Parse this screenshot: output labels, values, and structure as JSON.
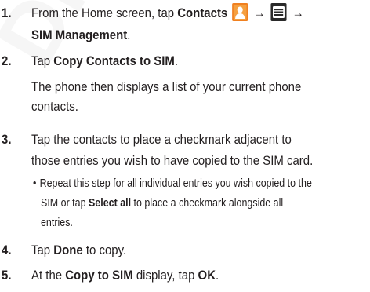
{
  "colors": {
    "text": "#231f20",
    "contacts_icon_bg": "#f08020",
    "menu_icon_bg": "#2a2a2a"
  },
  "steps": [
    {
      "number": "1.",
      "line1": {
        "pre": "From the Home screen, tap ",
        "bold1": "Contacts",
        "contacts_icon": "contacts-person-icon",
        "arrow1": "→",
        "menu_icon": "menu-list-icon",
        "arrow2": "→"
      },
      "line2": {
        "bold": "SIM Management",
        "post": "."
      }
    },
    {
      "number": "2.",
      "line1": {
        "pre": "Tap ",
        "bold": "Copy Contacts to SIM",
        "post": "."
      },
      "line2": "The phone then displays a list of your current phone",
      "line3": "contacts."
    },
    {
      "number": "3.",
      "line1": "Tap the contacts to place a checkmark adjacent to",
      "line2": "those entries you wish to have copied to the SIM card.",
      "sub": {
        "bullet": "•",
        "line1": "Repeat this step for all individual entries you wish copied to the",
        "line2_pre": "SIM or tap ",
        "line2_bold": "Select all",
        "line2_post": " to place a checkmark alongside all",
        "line3": "entries."
      }
    },
    {
      "number": "4.",
      "line1": {
        "pre": "Tap ",
        "bold": "Done",
        "post": " to copy."
      }
    },
    {
      "number": "5.",
      "line1": {
        "pre": "At the ",
        "bold1": "Copy to SIM",
        "mid": " display, tap ",
        "bold2": "OK",
        "post": "."
      }
    }
  ]
}
